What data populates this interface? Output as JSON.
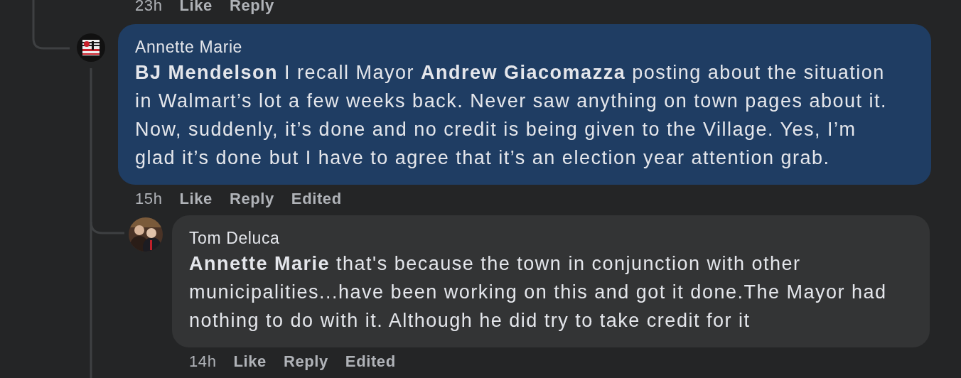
{
  "top_actions": {
    "time": "23h",
    "like": "Like",
    "reply": "Reply"
  },
  "comments": [
    {
      "author": "Annette Marie",
      "text": "**BJ Mendelson** I recall Mayor **Andrew Giacomazza** posting about the situation in Walmart’s lot a few weeks back. Never saw anything on town pages about it. Now, suddenly, it’s done and no credit is being given to the Village. Yes, I’m glad it’s done but I have to agree that it’s an election year attention grab.",
      "highlighted": true,
      "time": "15h",
      "like": "Like",
      "reply": "Reply",
      "edited": "Edited"
    },
    {
      "author": "Tom Deluca",
      "text": "**Annette Marie** that's because the town in conjunction with other municipalities...have been working on this and got it done.The Mayor had nothing to do with it. Although he did try to take credit for it",
      "highlighted": false,
      "time": "14h",
      "like": "Like",
      "reply": "Reply",
      "edited": "Edited"
    }
  ]
}
